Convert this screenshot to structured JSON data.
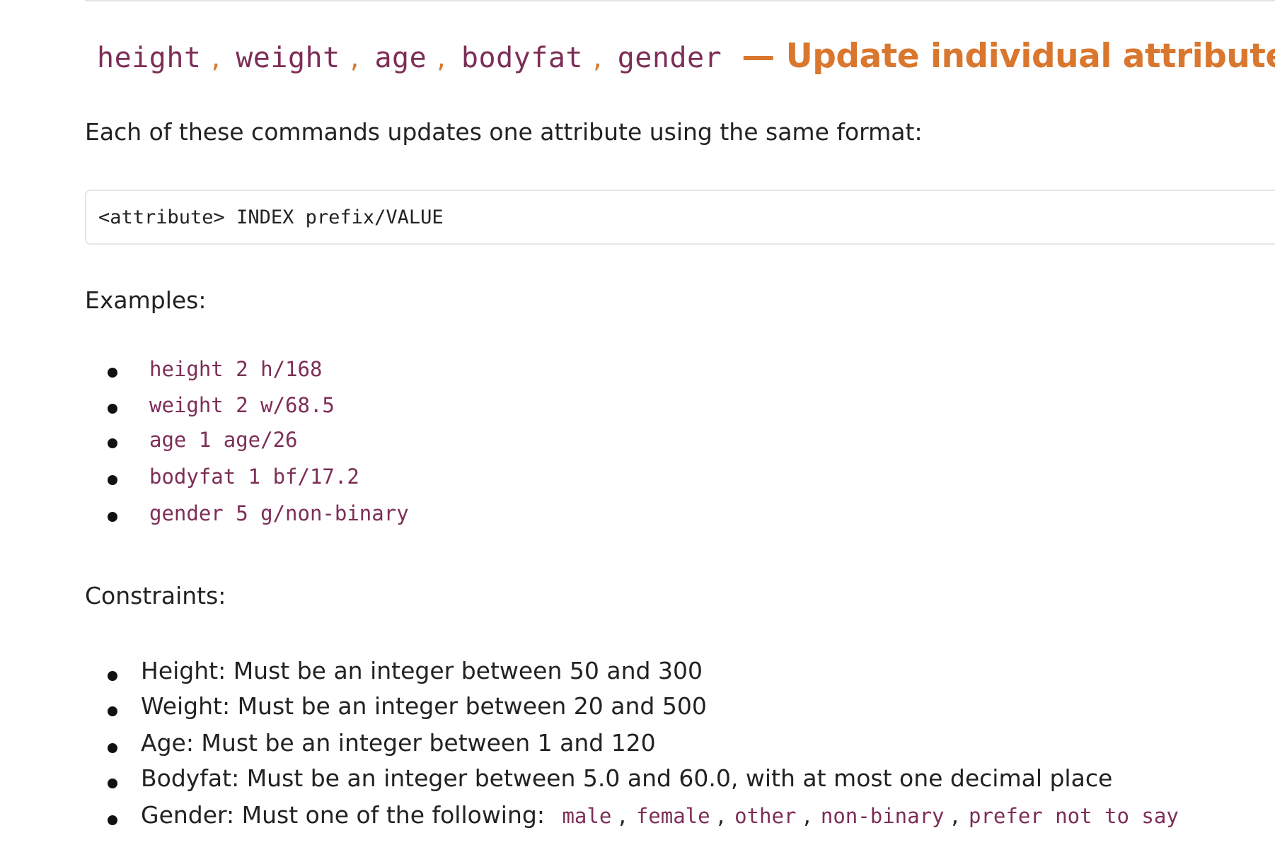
{
  "heading": {
    "commands": [
      "height",
      "weight",
      "age",
      "bodyfat",
      "gender"
    ],
    "separator": ",",
    "title": "— Update individual attributes"
  },
  "intro": "Each of these commands updates one attribute using the same format:",
  "format_code": "<attribute> INDEX prefix/VALUE",
  "examples_label": "Examples:",
  "examples": [
    "height 2 h/168",
    "weight 2 w/68.5",
    "age 1 age/26",
    "bodyfat 1 bf/17.2",
    "gender 5 g/non-binary"
  ],
  "constraints_label": "Constraints:",
  "constraints": [
    "Height: Must be an integer between 50 and 300",
    "Weight: Must be an integer between 20 and 500",
    "Age: Must be an integer between 1 and 120",
    "Bodyfat: Must be an integer between 5.0 and 60.0, with at most one decimal place"
  ],
  "gender_constraint": {
    "text": "Gender: Must one of the following:",
    "options": [
      "male",
      "female",
      "other",
      "non-binary",
      "prefer not to say"
    ]
  },
  "colors": {
    "accent_heading": "#d9772e",
    "code_text": "#7d2e57",
    "body_text": "#222222"
  }
}
